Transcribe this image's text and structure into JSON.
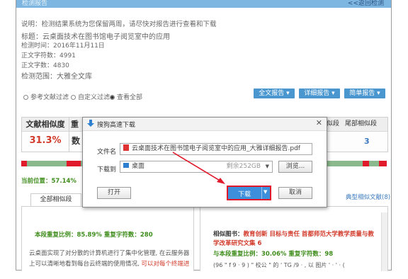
{
  "header": {
    "left": "检测报告",
    "right": "<<返回检测"
  },
  "notice": "说明：检测结果系统为您保留两周，请尽快对报告进行查看和下载",
  "meta": [
    "标题：云桌面技术在图书馆电子阅览室中的应用",
    "检测时间：2016年11月11日",
    "正文字符数：4991",
    "正文字数：4830",
    "检测范围：大雅全文库"
  ],
  "filters": {
    "opt1": "参考文献过滤",
    "opt2": "自定义过滤",
    "opt3": "查看全部"
  },
  "report_buttons": {
    "full": "全文报告 ▾",
    "detail": "详细报告 ▾",
    "simple": "简单报告 ▾"
  },
  "summary": {
    "label": "文献相似度",
    "value": "31.3%",
    "label2": "重",
    "label3": "数",
    "col_mid": "似段",
    "col_tail": "尾部相似段",
    "tail_value": "3"
  },
  "position": {
    "label": "当前位置：",
    "value": "57.14%"
  },
  "tabs": {
    "all_similar": "全部相似段",
    "typical": "典型相似文献",
    "typical_count": "(8)"
  },
  "left_panel": {
    "stats": "本段重复比例：85.89%  重复字符数：280",
    "text1": "云桌面实现了对分散的计算机进行了集中化管理, 在云服务器",
    "text2": "上可以清晰地看到每台云终端的使用情况,",
    "text2_red": " 可以对每个终端进"
  },
  "right_panel": {
    "prefix": "相似图书：",
    "red_title": "教育创新 目标与责任 首都师范大学教学质量与教学改革研究文集 6",
    "stats": "与本段重复比例：30.06%  重复字符数：98",
    "garble": "(96 \" f 9 · 9 ) \" 校公 \" 的 ' TG /9 · , 以 图片 ' · ' · ("
  },
  "dialog": {
    "title": "搜狗高速下载",
    "filename_label": "文件名",
    "filename": "云桌面技术在图书馆电子阅览室中的应用_大雅详细报告.pdf",
    "saveto_label": "下载到",
    "folder": "桌面",
    "space": "剩余252GB",
    "browse": "浏览...",
    "open": "打开",
    "download": "下载",
    "cancel": "取消"
  },
  "colors": {
    "accent_blue": "#4a97d0",
    "highlight_red": "#e0192b",
    "green_text": "#3f8d1c"
  }
}
